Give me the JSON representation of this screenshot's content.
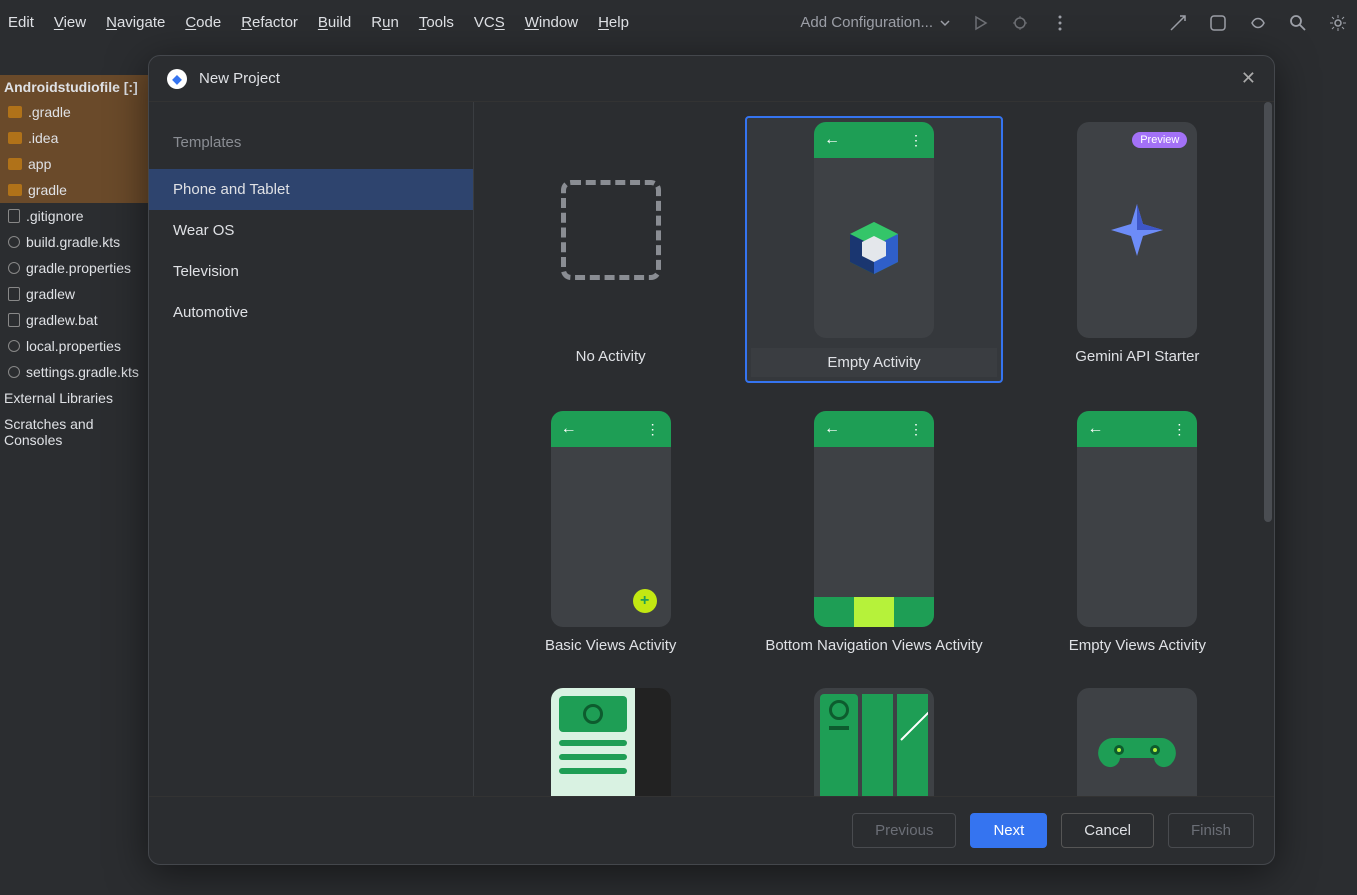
{
  "menubar": [
    "Edit",
    "View",
    "Navigate",
    "Code",
    "Refactor",
    "Build",
    "Run",
    "Tools",
    "VCS",
    "Window",
    "Help"
  ],
  "menubar_ul_first": [
    "E",
    "V",
    "N",
    "C",
    "R",
    "B",
    "R",
    "T",
    "V",
    "W",
    "H"
  ],
  "run_config": "Add Configuration...",
  "project": {
    "root": "Androidstudiofile [:]",
    "items": [
      {
        "name": ".gradle",
        "icon": "folder",
        "sel": true
      },
      {
        "name": ".idea",
        "icon": "folder",
        "sel": true
      },
      {
        "name": "app",
        "icon": "folder",
        "sel": true
      },
      {
        "name": "gradle",
        "icon": "folder",
        "sel": true
      },
      {
        "name": ".gitignore",
        "icon": "file"
      },
      {
        "name": "build.gradle.kts",
        "icon": "gear"
      },
      {
        "name": "gradle.properties",
        "icon": "gear"
      },
      {
        "name": "gradlew",
        "icon": "file"
      },
      {
        "name": "gradlew.bat",
        "icon": "file"
      },
      {
        "name": "local.properties",
        "icon": "gear"
      },
      {
        "name": "settings.gradle.kts",
        "icon": "gear"
      }
    ],
    "extra": [
      "External Libraries",
      "Scratches and Consoles"
    ]
  },
  "dialog": {
    "title": "New Project",
    "sidebar_header": "Templates",
    "categories": [
      "Phone and Tablet",
      "Wear OS",
      "Television",
      "Automotive"
    ],
    "selected_category": 0,
    "templates": [
      {
        "label": "No Activity",
        "kind": "none"
      },
      {
        "label": "Empty Activity",
        "kind": "compose",
        "selected": true
      },
      {
        "label": "Gemini API Starter",
        "kind": "gemini",
        "badge": "Preview"
      },
      {
        "label": "Basic Views Activity",
        "kind": "basic"
      },
      {
        "label": "Bottom Navigation Views Activity",
        "kind": "bottomnav"
      },
      {
        "label": "Empty Views Activity",
        "kind": "emptyviews"
      }
    ],
    "buttons": {
      "previous": "Previous",
      "next": "Next",
      "cancel": "Cancel",
      "finish": "Finish"
    }
  }
}
